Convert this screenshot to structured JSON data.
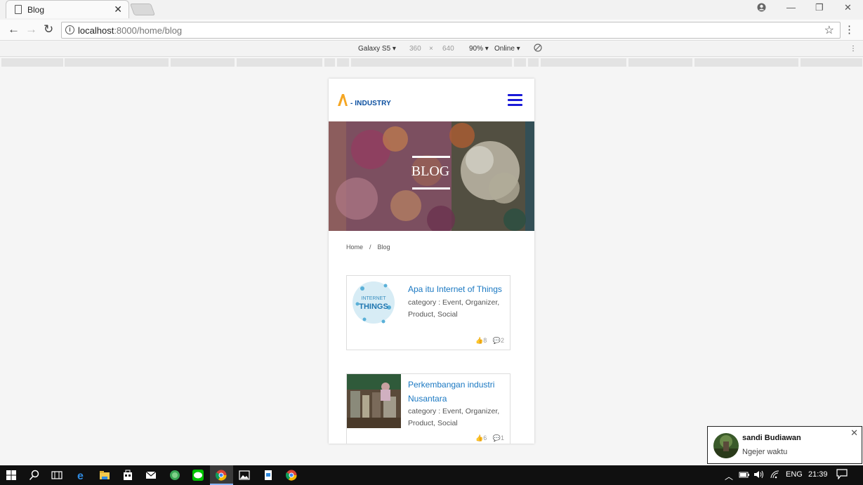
{
  "browser": {
    "tab_title": "Blog",
    "tab_close": "✕",
    "url_host": "localhost",
    "url_path": ":8000/home/blog",
    "star": "☆",
    "menu": "⋮"
  },
  "devtools": {
    "device": "Galaxy S5 ▾",
    "width": "360",
    "times": "×",
    "height": "640",
    "zoom": "90% ▾",
    "network": "Online ▾",
    "menu": "⋮"
  },
  "site": {
    "logo_text": "- INDUSTRY",
    "hero_title": "BLOG",
    "breadcrumb": {
      "home": "Home",
      "sep": "/",
      "current": "Blog"
    },
    "posts": [
      {
        "title": "Apa itu Internet of Things",
        "category_line1": "category : Event, Organizer,",
        "category_line2": "Product, Social",
        "likes": "8",
        "comments": "2",
        "thumb_text_1": "INTERNET",
        "thumb_text_2": "THINGS"
      },
      {
        "title_line1": "Perkembangan industri",
        "title_line2": "Nusantara",
        "category_line1": "category : Event, Organizer,",
        "category_line2": "Product, Social",
        "likes": "6",
        "comments": "1"
      }
    ]
  },
  "notification": {
    "name": "sandi Budiawan",
    "message": "Ngejer waktu",
    "close": "✕"
  },
  "taskbar": {
    "lang": "ENG",
    "time": "21:39"
  },
  "colors": {
    "accent_blue": "#1a78c2",
    "logo_orange": "#f5a623",
    "menu_blue": "#1a1ad8"
  }
}
